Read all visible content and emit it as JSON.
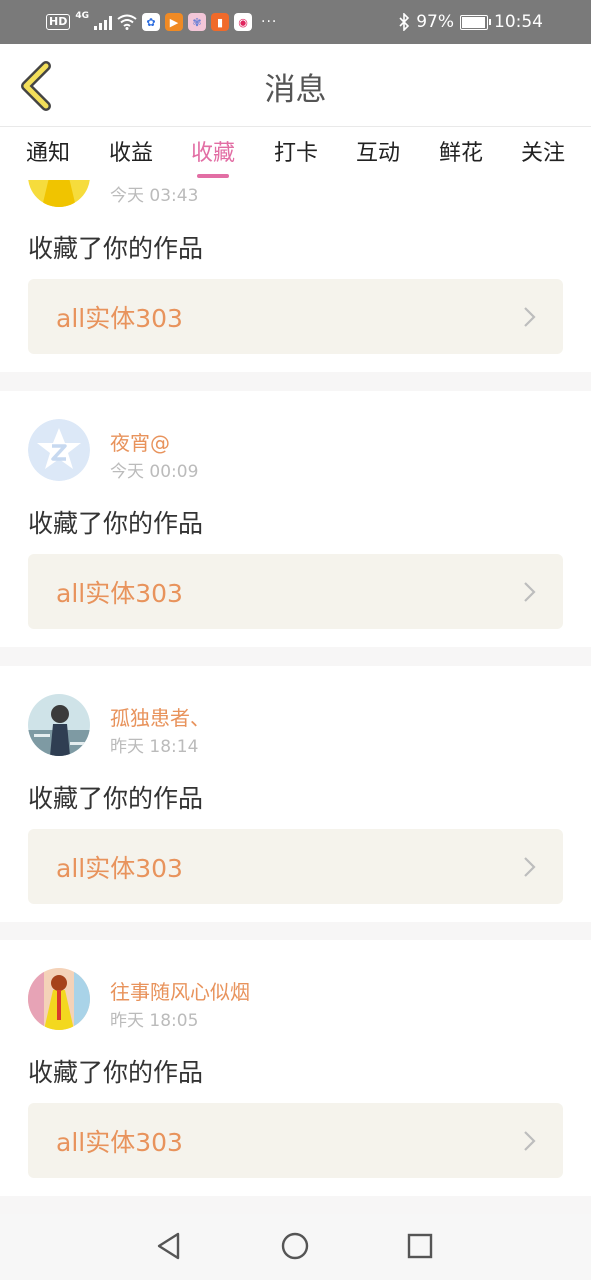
{
  "status_bar": {
    "hd": "HD",
    "network": "4G",
    "dots": "···",
    "battery": "97%",
    "time": "10:54"
  },
  "header": {
    "title": "消息"
  },
  "tabs": [
    {
      "label": "通知"
    },
    {
      "label": "收益"
    },
    {
      "label": "收藏",
      "active": true
    },
    {
      "label": "打卡"
    },
    {
      "label": "互动"
    },
    {
      "label": "鲜花"
    },
    {
      "label": "关注"
    }
  ],
  "items": [
    {
      "user": "",
      "time": "今天 03:43",
      "action": "收藏了你的作品",
      "work": "all实体303"
    },
    {
      "user": "夜宵@",
      "time": "今天 00:09",
      "action": "收藏了你的作品",
      "work": "all实体303"
    },
    {
      "user": "孤独患者、",
      "time": "昨天 18:14",
      "action": "收藏了你的作品",
      "work": "all实体303"
    },
    {
      "user": "往事随风心似烟",
      "time": "昨天 18:05",
      "action": "收藏了你的作品",
      "work": "all实体303"
    }
  ],
  "colors": {
    "accent_pink": "#e26ea4",
    "username_orange": "#e8935c",
    "status_bar": "#7a7a7a",
    "work_box": "#f5f3ec"
  },
  "icons": {
    "back": "chevron-left-icon",
    "work_arrow": "chevron-right-icon",
    "nav_back": "triangle-back-icon",
    "nav_home": "circle-home-icon",
    "nav_recents": "square-recents-icon"
  }
}
